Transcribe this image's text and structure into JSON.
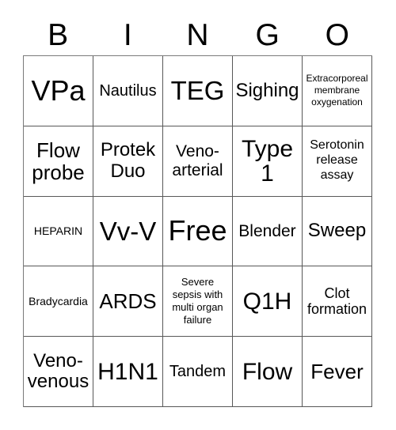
{
  "card": {
    "type": "bingo-card",
    "background_color": "#ffffff",
    "text_color": "#000000",
    "grid_line_color": "#585858",
    "columns": 5,
    "rows": 5
  },
  "header": {
    "letters": [
      "B",
      "I",
      "N",
      "G",
      "O"
    ]
  },
  "grid": {
    "rows": [
      {
        "cells": [
          {
            "text": "VPa",
            "size": "fs-36"
          },
          {
            "text": "Nautilus",
            "size": "fs-20"
          },
          {
            "text": "TEG",
            "size": "fs-33"
          },
          {
            "text": "Sighing",
            "size": "fs-24"
          },
          {
            "text": "Extracorporeal membrane oxygenation",
            "size": "fs-12"
          }
        ]
      },
      {
        "cells": [
          {
            "text": "Flow probe",
            "size": "fs-26"
          },
          {
            "text": "Protek Duo",
            "size": "fs-24"
          },
          {
            "text": "Veno-arterial",
            "size": "fs-21"
          },
          {
            "text": "Type 1",
            "size": "fs-30"
          },
          {
            "text": "Serotonin release assay",
            "size": "fs-16"
          }
        ]
      },
      {
        "cells": [
          {
            "text": "HEPARIN",
            "size": "fs-14"
          },
          {
            "text": "Vv-V",
            "size": "fs-33"
          },
          {
            "text": "Free",
            "size": "fs-36"
          },
          {
            "text": "Blender",
            "size": "fs-21"
          },
          {
            "text": "Sweep",
            "size": "fs-24"
          }
        ]
      },
      {
        "cells": [
          {
            "text": "Bradycardia",
            "size": "fs-14"
          },
          {
            "text": "ARDS",
            "size": "fs-26"
          },
          {
            "text": "Severe sepsis with multi organ failure",
            "size": "fs-13"
          },
          {
            "text": "Q1H",
            "size": "fs-30"
          },
          {
            "text": "Clot formation",
            "size": "fs-18"
          }
        ]
      },
      {
        "cells": [
          {
            "text": "Veno-venous",
            "size": "fs-24"
          },
          {
            "text": "H1N1",
            "size": "fs-30"
          },
          {
            "text": "Tandem",
            "size": "fs-20"
          },
          {
            "text": "Flow",
            "size": "fs-30"
          },
          {
            "text": "Fever",
            "size": "fs-26"
          }
        ]
      }
    ]
  }
}
